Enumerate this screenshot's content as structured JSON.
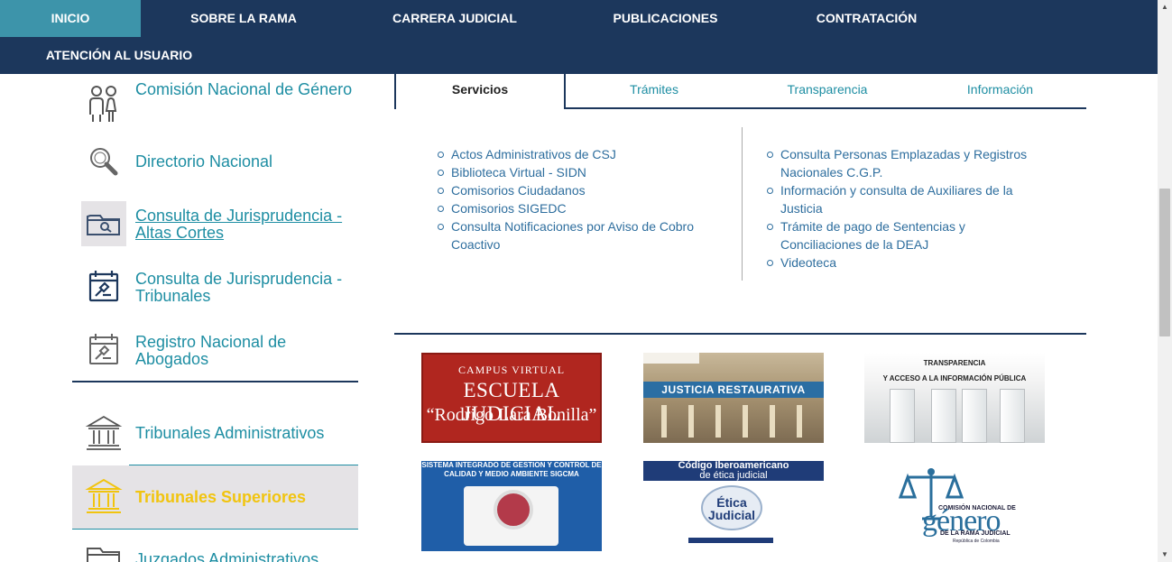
{
  "nav": {
    "items": [
      "INICIO",
      "SOBRE LA RAMA",
      "CARRERA JUDICIAL",
      "PUBLICACIONES",
      "CONTRATACIÓN",
      "ATENCIÓN AL USUARIO"
    ],
    "active": "INICIO"
  },
  "sidebar": {
    "items": [
      {
        "label": "Comisión Nacional de Género",
        "icon": "people-icon"
      },
      {
        "label": "Directorio Nacional",
        "icon": "magnifier-icon"
      },
      {
        "label": "Consulta de Jurisprudencia - Altas Cortes",
        "icon": "folder-search-icon"
      },
      {
        "label": "Consulta de Jurisprudencia - Tribunales",
        "icon": "calendar-gavel-icon"
      },
      {
        "label": "Registro Nacional de Abogados",
        "icon": "calendar-gavel-icon"
      },
      {
        "label": "Tribunales Administrativos",
        "icon": "courthouse-icon"
      },
      {
        "label": "Tribunales Superiores",
        "icon": "courthouse-icon"
      },
      {
        "label": "Juzgados Administrativos",
        "icon": "folder-icon"
      }
    ]
  },
  "tabs": [
    "Servicios",
    "Trámites",
    "Transparencia",
    "Información"
  ],
  "services": {
    "left": [
      "Actos Administrativos de CSJ",
      "Biblioteca Virtual - SIDN",
      "Comisorios Ciudadanos",
      "Comisorios SIGEDC",
      "Consulta Notificaciones por Aviso de Cobro Coactivo"
    ],
    "right": [
      "Consulta Personas Emplazadas y Registros Nacionales C.G.P.",
      "Información y consulta de Auxiliares de la Justicia",
      "Trámite de pago de Sentencias y Conciliaciones de la DEAJ",
      "Videoteca"
    ]
  },
  "banners": {
    "campus": {
      "line1": "CAMPUS VIRTUAL",
      "line2": "ESCUELA JUDICIAL",
      "line3": "“Rodrigo Lara Bonilla”"
    },
    "justicia": {
      "label": "JUSTICIA RESTAURATIVA"
    },
    "transparencia": {
      "line1": "TRANSPARENCIA",
      "line2": "Y ACCESO A LA INFORMACIÓN PÚBLICA"
    },
    "sigcma": {
      "text": "SISTEMA INTEGRADO DE GESTION Y CONTROL DE CALIDAD Y MEDIO AMBIENTE SIGCMA"
    },
    "etica": {
      "line1": "Código Iberoamericano",
      "line2": "de ética judicial",
      "globe": "Ética Judicial"
    },
    "genero": {
      "line1": "COMISIÓN NACIONAL DE",
      "big": "género",
      "line2": "DE LA RAMA JUDICIAL",
      "line3": "República de Colombia"
    }
  },
  "colors": {
    "navy": "#1c375c",
    "teal": "#3d94aa",
    "link": "#1e8ea3",
    "gold": "#f1c40f"
  }
}
